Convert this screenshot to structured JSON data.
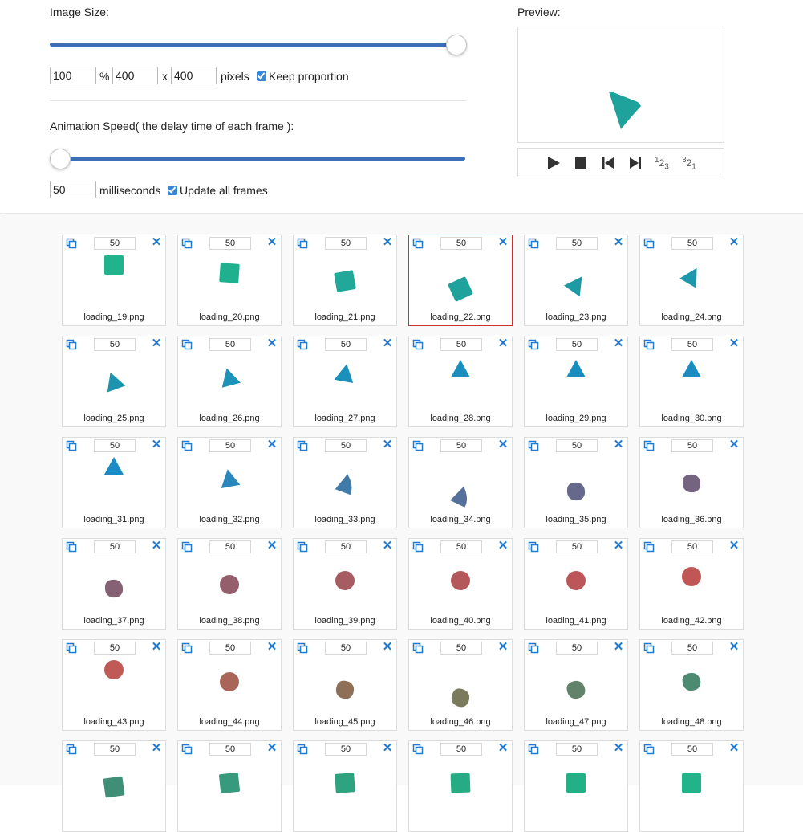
{
  "image_size": {
    "label": "Image Size:",
    "percent_value": "100",
    "percent_suffix": "%",
    "width_value": "400",
    "times_label": "x",
    "height_value": "400",
    "pixels_label": "pixels",
    "keep_proportion_label": "Keep proportion",
    "keep_proportion_checked": true,
    "slider_fraction": 1.0
  },
  "animation_speed": {
    "label": "Animation Speed( the delay time of each frame ):",
    "delay_value": "50",
    "ms_label": "milliseconds",
    "update_all_label": "Update all frames",
    "update_all_checked": true,
    "slider_fraction": 0.0
  },
  "preview": {
    "label": "Preview:",
    "controls": [
      {
        "name": "play-icon"
      },
      {
        "name": "stop-icon"
      },
      {
        "name": "skip-back-icon"
      },
      {
        "name": "skip-forward-icon"
      },
      {
        "name": "order-forward-icon",
        "text": "123"
      },
      {
        "name": "order-reverse-icon",
        "text": "321"
      }
    ]
  },
  "colors": {
    "accent": "#3d6fb8",
    "icon_blue": "#1f7ad1",
    "selected_border": "#cc2f2f"
  },
  "frames": [
    {
      "filename": "loading_19.png",
      "delay": "50",
      "color": "#21b48c",
      "shape": "square",
      "selected": false
    },
    {
      "filename": "loading_20.png",
      "delay": "50",
      "color": "#21b08e",
      "shape": "square",
      "selected": false
    },
    {
      "filename": "loading_21.png",
      "delay": "50",
      "color": "#20a898",
      "shape": "square",
      "selected": false
    },
    {
      "filename": "loading_22.png",
      "delay": "50",
      "color": "#1fa29c",
      "shape": "square",
      "selected": true
    },
    {
      "filename": "loading_23.png",
      "delay": "50",
      "color": "#1e9aa4",
      "shape": "triangle",
      "selected": false
    },
    {
      "filename": "loading_24.png",
      "delay": "50",
      "color": "#1d97aa",
      "shape": "triangle",
      "selected": false
    },
    {
      "filename": "loading_25.png",
      "delay": "50",
      "color": "#1c94b0",
      "shape": "triangle",
      "selected": false
    },
    {
      "filename": "loading_26.png",
      "delay": "50",
      "color": "#1b92b6",
      "shape": "triangle",
      "selected": false
    },
    {
      "filename": "loading_27.png",
      "delay": "50",
      "color": "#1b90ba",
      "shape": "triangle",
      "selected": false
    },
    {
      "filename": "loading_28.png",
      "delay": "50",
      "color": "#1a8ebe",
      "shape": "triangle",
      "selected": false
    },
    {
      "filename": "loading_29.png",
      "delay": "50",
      "color": "#1a8dc0",
      "shape": "triangle",
      "selected": false
    },
    {
      "filename": "loading_30.png",
      "delay": "50",
      "color": "#1a8cc2",
      "shape": "triangle",
      "selected": false
    },
    {
      "filename": "loading_31.png",
      "delay": "50",
      "color": "#1a8bc4",
      "shape": "triangle",
      "selected": false
    },
    {
      "filename": "loading_32.png",
      "delay": "50",
      "color": "#2a87bd",
      "shape": "triangle",
      "selected": false
    },
    {
      "filename": "loading_33.png",
      "delay": "50",
      "color": "#3f7aa8",
      "shape": "wedge",
      "selected": false
    },
    {
      "filename": "loading_34.png",
      "delay": "50",
      "color": "#55709a",
      "shape": "wedge",
      "selected": false
    },
    {
      "filename": "loading_35.png",
      "delay": "50",
      "color": "#66698c",
      "shape": "blob",
      "selected": false
    },
    {
      "filename": "loading_36.png",
      "delay": "50",
      "color": "#746480",
      "shape": "blob",
      "selected": false
    },
    {
      "filename": "loading_37.png",
      "delay": "50",
      "color": "#856174",
      "shape": "blob",
      "selected": false
    },
    {
      "filename": "loading_38.png",
      "delay": "50",
      "color": "#955e6c",
      "shape": "circle",
      "selected": false
    },
    {
      "filename": "loading_39.png",
      "delay": "50",
      "color": "#a75c62",
      "shape": "circle",
      "selected": false
    },
    {
      "filename": "loading_40.png",
      "delay": "50",
      "color": "#b5585c",
      "shape": "circle",
      "selected": false
    },
    {
      "filename": "loading_41.png",
      "delay": "50",
      "color": "#bd5658",
      "shape": "circle",
      "selected": false
    },
    {
      "filename": "loading_42.png",
      "delay": "50",
      "color": "#c05656",
      "shape": "circle",
      "selected": false
    },
    {
      "filename": "loading_43.png",
      "delay": "50",
      "color": "#bf5a56",
      "shape": "circle",
      "selected": false
    },
    {
      "filename": "loading_44.png",
      "delay": "50",
      "color": "#a96658",
      "shape": "circle",
      "selected": false
    },
    {
      "filename": "loading_45.png",
      "delay": "50",
      "color": "#8e7058",
      "shape": "blob",
      "selected": false
    },
    {
      "filename": "loading_46.png",
      "delay": "50",
      "color": "#7a7a5c",
      "shape": "blob",
      "selected": false
    },
    {
      "filename": "loading_47.png",
      "delay": "50",
      "color": "#62826a",
      "shape": "blob",
      "selected": false
    },
    {
      "filename": "loading_48.png",
      "delay": "50",
      "color": "#4c8a72",
      "shape": "blob",
      "selected": false
    },
    {
      "filename": "",
      "delay": "50",
      "color": "#3f8e76",
      "shape": "square",
      "selected": false
    },
    {
      "filename": "",
      "delay": "50",
      "color": "#379a7c",
      "shape": "square",
      "selected": false
    },
    {
      "filename": "",
      "delay": "50",
      "color": "#2ea380",
      "shape": "square",
      "selected": false
    },
    {
      "filename": "",
      "delay": "50",
      "color": "#26ab84",
      "shape": "square",
      "selected": false
    },
    {
      "filename": "",
      "delay": "50",
      "color": "#22b187",
      "shape": "square",
      "selected": false
    },
    {
      "filename": "",
      "delay": "50",
      "color": "#21b48a",
      "shape": "square",
      "selected": false
    }
  ]
}
